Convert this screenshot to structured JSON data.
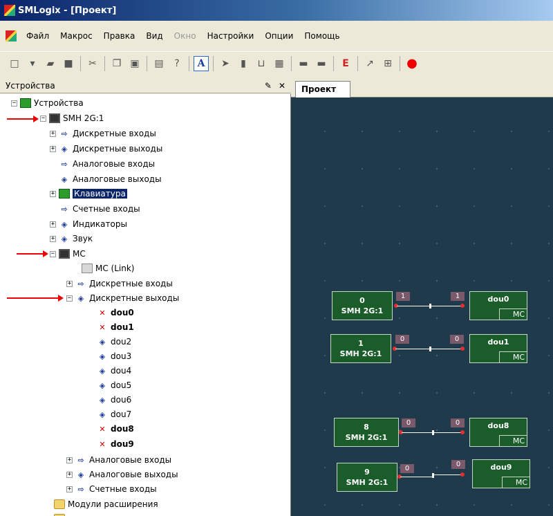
{
  "window": {
    "title": "SMLogix - [Проект]"
  },
  "menu": [
    "Файл",
    "Макрос",
    "Правка",
    "Вид",
    "Окно",
    "Настройки",
    "Опции",
    "Помощь"
  ],
  "panel": {
    "title": "Устройства"
  },
  "tree": {
    "root": "Устройства",
    "device": "SMH 2G:1",
    "device_children": [
      "Дискретные входы",
      "Дискретные выходы",
      "Аналоговые входы",
      "Аналоговые выходы",
      "Клавиатура",
      "Счетные входы",
      "Индикаторы",
      "Звук"
    ],
    "mc": "MC",
    "mc_children": [
      "MC (Link)",
      "Дискретные входы",
      "Дискретные выходы"
    ],
    "outputs": [
      "dou0",
      "dou1",
      "dou2",
      "dou3",
      "dou4",
      "dou5",
      "dou6",
      "dou7",
      "dou8",
      "dou9"
    ],
    "mc_rest": [
      "Аналоговые входы",
      "Аналоговые выходы",
      "Счетные входы"
    ],
    "modules": "Модули расширения"
  },
  "tabs": [
    "Проект"
  ],
  "blocks": [
    {
      "src_num": "0",
      "src_name": "SMH 2G:1",
      "badge_a": "1",
      "badge_b": "1",
      "dst_name": "dou0",
      "dst_tag": "MC"
    },
    {
      "src_num": "1",
      "src_name": "SMH 2G:1",
      "badge_a": "0",
      "badge_b": "0",
      "dst_name": "dou1",
      "dst_tag": "MC"
    },
    {
      "src_num": "8",
      "src_name": "SMH 2G:1",
      "badge_a": "0",
      "badge_b": "0",
      "dst_name": "dou8",
      "dst_tag": "MC"
    },
    {
      "src_num": "9",
      "src_name": "SMH 2G:1",
      "badge_a": "0",
      "badge_b": "0",
      "dst_name": "dou9",
      "dst_tag": "MC"
    }
  ]
}
